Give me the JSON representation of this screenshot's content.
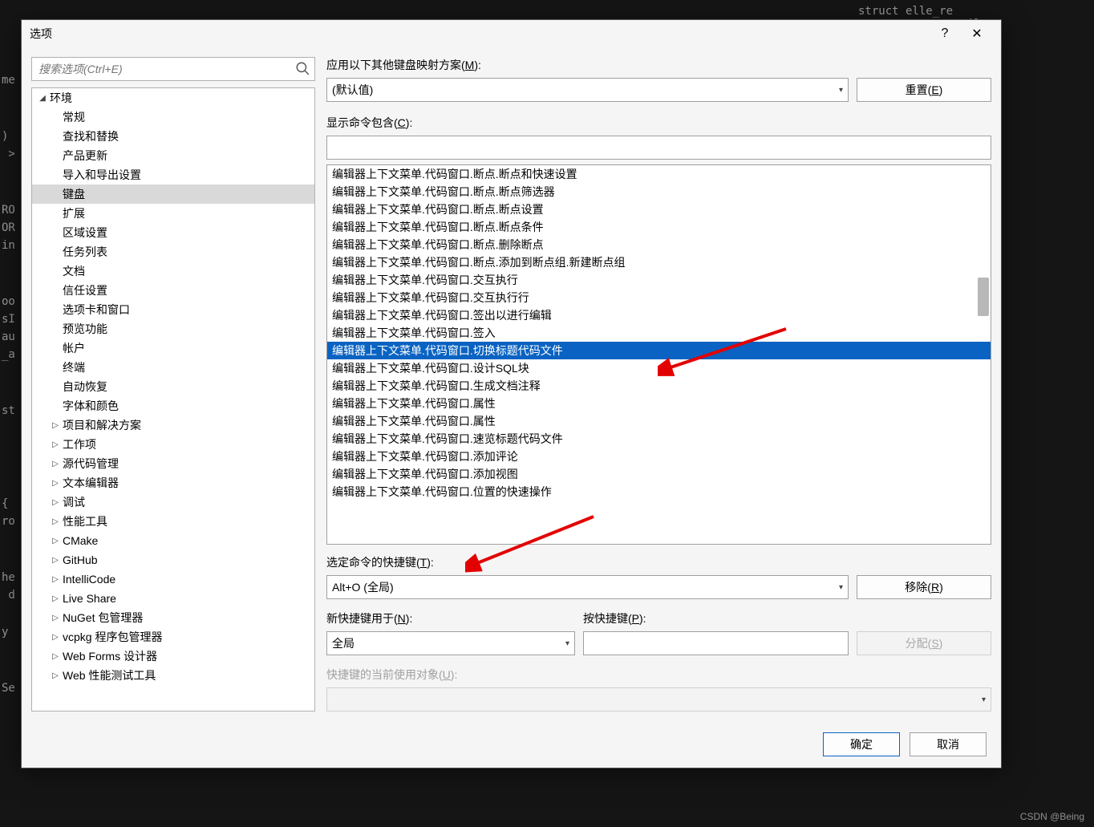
{
  "bg": {
    "lines": {
      "l1": "me",
      "l2": ")",
      "l3": " >",
      "l4": "RO",
      "l5": "OR",
      "l6": "in",
      "l7": "oo",
      "l8": "sI",
      "l9": "au",
      "l10": "_a",
      "l11": "st",
      "l12": "{",
      "l13": "ro",
      "l14": "he",
      "l15": " d",
      "l16": "y ",
      "l17": "Se",
      "r1": "struct elle_re",
      "r2": "        til"
    }
  },
  "dialog": {
    "title": "选项",
    "help": "?",
    "close": "✕"
  },
  "search": {
    "placeholder": "搜索选项(Ctrl+E)"
  },
  "tree": {
    "env": "环境",
    "items": [
      "常规",
      "查找和替换",
      "产品更新",
      "导入和导出设置",
      "键盘",
      "扩展",
      "区域设置",
      "任务列表",
      "文档",
      "信任设置",
      "选项卡和窗口",
      "预览功能",
      "帐户",
      "终端",
      "自动恢复",
      "字体和颜色"
    ],
    "cats": [
      "项目和解决方案",
      "工作项",
      "源代码管理",
      "文本编辑器",
      "调试",
      "性能工具",
      "CMake",
      "GitHub",
      "IntelliCode",
      "Live Share",
      "NuGet 包管理器",
      "vcpkg 程序包管理器",
      "Web Forms 设计器",
      "Web 性能测试工具"
    ]
  },
  "right": {
    "apply_label_a": "应用以下其他键盘映射方案(",
    "apply_label_u": "M",
    "apply_label_b": "):",
    "apply_value": "(默认值)",
    "reset": "重置(",
    "reset_u": "E",
    "reset_b": ")",
    "contain_a": "显示命令包含(",
    "contain_u": "C",
    "contain_b": "):",
    "commands": [
      "编辑器上下文菜单.代码窗口.断点.断点和快速设置",
      "编辑器上下文菜单.代码窗口.断点.断点筛选器",
      "编辑器上下文菜单.代码窗口.断点.断点设置",
      "编辑器上下文菜单.代码窗口.断点.断点条件",
      "编辑器上下文菜单.代码窗口.断点.删除断点",
      "编辑器上下文菜单.代码窗口.断点.添加到断点组.新建断点组",
      "编辑器上下文菜单.代码窗口.交互执行",
      "编辑器上下文菜单.代码窗口.交互执行行",
      "编辑器上下文菜单.代码窗口.签出以进行编辑",
      "编辑器上下文菜单.代码窗口.签入",
      "编辑器上下文菜单.代码窗口.切换标题代码文件",
      "编辑器上下文菜单.代码窗口.设计SQL块",
      "编辑器上下文菜单.代码窗口.生成文档注释",
      "编辑器上下文菜单.代码窗口.属性",
      "编辑器上下文菜单.代码窗口.属性",
      "编辑器上下文菜单.代码窗口.速览标题代码文件",
      "编辑器上下文菜单.代码窗口.添加评论",
      "编辑器上下文菜单.代码窗口.添加视图",
      "编辑器上下文菜单.代码窗口.位置的快速操作"
    ],
    "selected_command_index": 10,
    "shortcut_a": "选定命令的快捷键(",
    "shortcut_u": "T",
    "shortcut_b": "):",
    "shortcut_value": "Alt+O (全局)",
    "remove": "移除(",
    "remove_u": "R",
    "remove_b": ")",
    "newfor_a": "新快捷键用于(",
    "newfor_u": "N",
    "newfor_b": "):",
    "newfor_value": "全局",
    "press_a": "按快捷键(",
    "press_u": "P",
    "press_b": "):",
    "assign": "分配(",
    "assign_u": "S",
    "assign_b": ")",
    "curuse_a": "快捷键的当前使用对象(",
    "curuse_u": "U",
    "curuse_b": "):"
  },
  "bottom": {
    "ok": "确定",
    "cancel": "取消"
  },
  "watermark": "CSDN @Being"
}
